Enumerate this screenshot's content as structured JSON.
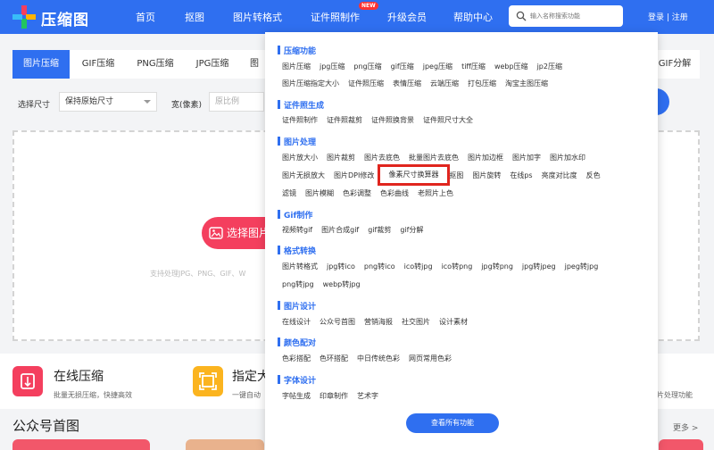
{
  "header": {
    "logo_text": "压缩图",
    "nav": [
      "首页",
      "抠图",
      "图片转格式",
      "证件照制作",
      "升级会员",
      "帮助中心"
    ],
    "new_badge": "NEW",
    "search_placeholder": "输入名称搜索功能",
    "login": "登录 | 注册"
  },
  "tabs": [
    "图片压缩",
    "GIF压缩",
    "PNG压缩",
    "JPG压缩",
    "图",
    "GIF分解"
  ],
  "options": {
    "size_label": "选择尺寸",
    "size_value": "保持原始尺寸",
    "width_label": "宽(像素)",
    "ratio_placeholder": "原比例"
  },
  "upload": {
    "button": "选择图片",
    "hint": "支持处理JPG、PNG、GIF、W"
  },
  "features": [
    {
      "title": "在线压缩",
      "desc": "批量无损压缩，快捷高效"
    },
    {
      "title": "指定大",
      "desc": "一键自动"
    }
  ],
  "features_right": "片处理功能",
  "gzh": {
    "title": "公众号首图",
    "more": "更多 >"
  },
  "menu": {
    "sections": [
      {
        "title": "压缩功能",
        "rows": [
          [
            "图片压缩",
            "jpg压缩",
            "png压缩",
            "gif压缩",
            "jpeg压缩",
            "tiff压缩",
            "webp压缩",
            "jp2压缩"
          ],
          [
            "图片压缩指定大小",
            "证件照压缩",
            "表情压缩",
            "云端压缩",
            "打包压缩",
            "淘宝主图压缩"
          ]
        ]
      },
      {
        "title": "证件照生成",
        "rows": [
          [
            "证件照制作",
            "证件照裁剪",
            "证件照换背景",
            "证件照尺寸大全"
          ]
        ]
      },
      {
        "title": "图片处理",
        "rows": [
          [
            "图片放大小",
            "图片裁剪",
            "图片去底色",
            "批量图片去底色",
            "图片加边框",
            "图片加字",
            "图片加水印"
          ],
          [
            "图片无损放大",
            "图片DPI修改",
            "",
            "抠图",
            "图片旋转",
            "在线ps",
            "亮度对比度",
            "反色"
          ],
          [
            "滤镜",
            "图片模糊",
            "色彩调整",
            "色彩曲线",
            "老照片上色"
          ]
        ]
      },
      {
        "title": "Gif制作",
        "rows": [
          [
            "视频转gif",
            "图片合成gif",
            "gif裁剪",
            "gif分解"
          ]
        ]
      },
      {
        "title": "格式转换",
        "rows": [
          [
            "图片转格式",
            "jpg转ico",
            "png转ico",
            "ico转jpg",
            "ico转png",
            "jpg转png",
            "jpg转jpeg",
            "jpeg转jpg"
          ],
          [
            "png转jpg",
            "webp转jpg"
          ]
        ]
      },
      {
        "title": "图片设计",
        "rows": [
          [
            "在线设计",
            "公众号首图",
            "营销海报",
            "社交图片",
            "设计素材"
          ]
        ]
      },
      {
        "title": "颜色配对",
        "rows": [
          [
            "色彩搭配",
            "色环搭配",
            "中日传统色彩",
            "网页常用色彩"
          ]
        ]
      },
      {
        "title": "字体设计",
        "rows": [
          [
            "字帖生成",
            "印章制作",
            "艺术字"
          ]
        ]
      }
    ],
    "highlight": "像素尺寸换算器",
    "view_all": "查看所有功能"
  },
  "colors": {
    "brand": "#2f6ff0",
    "accent": "#f43f5e",
    "highlight_border": "#e0251e"
  }
}
